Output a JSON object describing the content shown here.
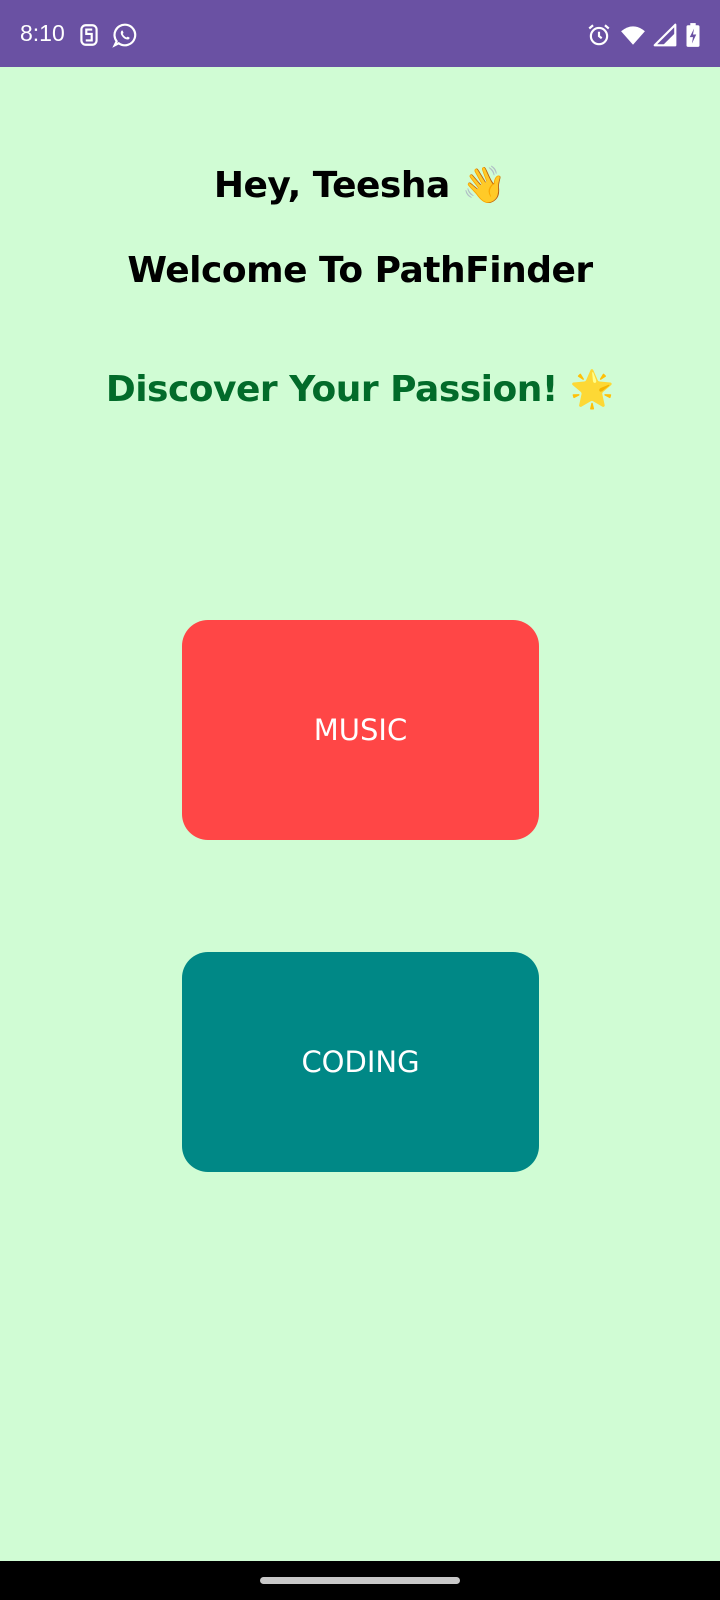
{
  "status_bar": {
    "time": "8:10",
    "left_icons": [
      "s-app-icon",
      "whatsapp-icon"
    ],
    "right_icons": [
      "alarm-icon",
      "wifi-icon",
      "signal-icon",
      "battery-charging-icon"
    ],
    "background": "#6a51a3"
  },
  "header": {
    "greeting": "Hey, Teesha 👋",
    "welcome": "Welcome To PathFinder",
    "tagline": "Discover Your Passion! 🌟"
  },
  "options": [
    {
      "label": "MUSIC",
      "color": "#ff4646"
    },
    {
      "label": "CODING",
      "color": "#008886"
    }
  ],
  "colors": {
    "background": "#d0fcd4",
    "tagline": "#026b2a",
    "text": "#000000"
  }
}
